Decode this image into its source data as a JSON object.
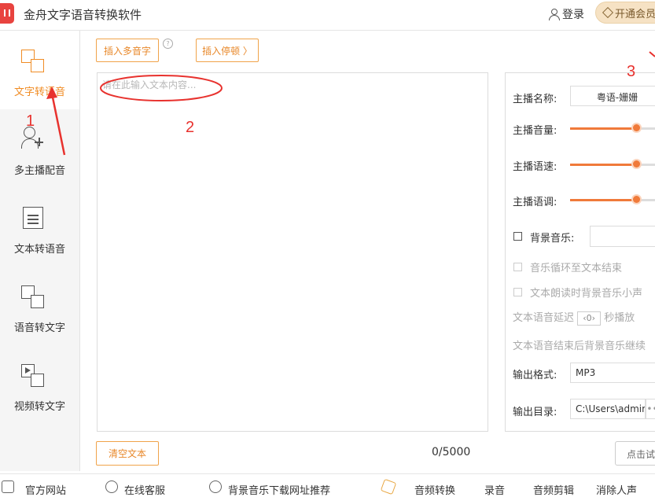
{
  "window": {
    "title": "金舟文字语音转换软件"
  },
  "header": {
    "login_label": "登录",
    "vip_label": "开通会员"
  },
  "sidebar": {
    "items": [
      {
        "label": "文字转语音",
        "active": true
      },
      {
        "label": "多主播配音"
      },
      {
        "label": "文本转语音"
      },
      {
        "label": "语音转文字"
      },
      {
        "label": "视频转文字"
      }
    ]
  },
  "toolbar": {
    "insert_polyphone_label": "插入多音字",
    "insert_pause_label": "插入停顿 〉"
  },
  "editor": {
    "placeholder": "请在此输入文本内容...",
    "clear_label": "清空文本",
    "count": "0/5000"
  },
  "settings": {
    "anchor_name_label": "主播名称:",
    "anchor_name_value": "粤语-姗姗",
    "volume_label": "主播音量:",
    "speed_label": "主播语速:",
    "pitch_label": "主播语调:",
    "volume_value": 0.7,
    "speed_value": 0.7,
    "pitch_value": 0.7,
    "bg_music_label": "背景音乐:",
    "loop_label": "音乐循环至文本结束",
    "duck_label": "文本朗读时背景音乐小声",
    "delay_prefix": "文本语音延迟",
    "delay_value": "0",
    "delay_suffix": "秒播放",
    "after_end_label": "文本语音结束后背景音乐继续",
    "format_label": "输出格式:",
    "format_value": "MP3",
    "dir_label": "输出目录:",
    "dir_value": "C:\\Users\\admir",
    "test_label": "点击试听"
  },
  "footer": {
    "items": [
      "官方网站",
      "在线客服",
      "背景音乐下载网址推荐",
      "音频转换",
      "录音",
      "音频剪辑",
      "消除人声"
    ]
  },
  "annotations": {
    "one": "1",
    "two": "2",
    "three": "3"
  },
  "colors": {
    "accent": "#f08c24",
    "annotation": "#e8322e"
  }
}
